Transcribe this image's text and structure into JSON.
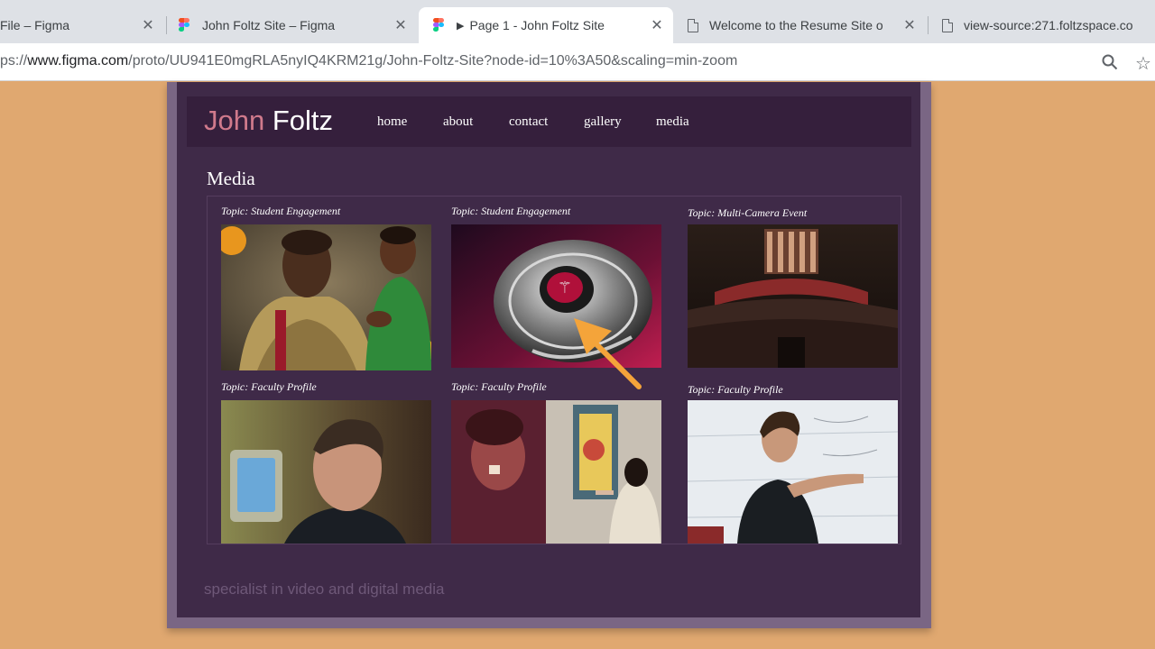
{
  "tabs": [
    {
      "title": "File – Figma",
      "icon": "figma-icon"
    },
    {
      "title": "John Foltz Site – Figma",
      "icon": "figma-icon"
    },
    {
      "title": "Page 1 - John Foltz Site",
      "icon": "figma-icon",
      "active": true
    },
    {
      "title": "Welcome to the Resume Site o",
      "icon": "document-icon"
    },
    {
      "title": "view-source:271.foltzspace.co",
      "icon": "document-icon"
    }
  ],
  "tab_close_glyph": "✕",
  "address": {
    "prefix": "ps://",
    "host": "www.figma.com",
    "path": "/proto/UU941E0mgRLA5nyIQ4KRM21g/John-Foltz-Site?node-id=10%3A50&scaling=min-zoom"
  },
  "site": {
    "brand_first": "John",
    "brand_last": "Foltz",
    "nav": [
      "home",
      "about",
      "contact",
      "gallery",
      "media"
    ],
    "heading": "Media",
    "cards": [
      {
        "label": "Topic: Student Engagement"
      },
      {
        "label": "Topic: Student Engagement"
      },
      {
        "label": "Topic: Multi-Camera Event"
      },
      {
        "label": "Topic: Faculty Profile"
      },
      {
        "label": "Topic: Faculty Profile"
      },
      {
        "label": "Topic: Faculty Profile"
      }
    ],
    "tagline": "specialist in video and digital media"
  },
  "colors": {
    "page_bg": "#e0a870",
    "site_bg": "#3f2a48",
    "header_bg": "#351f3c",
    "brand_accent": "#d07a8c",
    "arrow": "#f4a43a"
  }
}
